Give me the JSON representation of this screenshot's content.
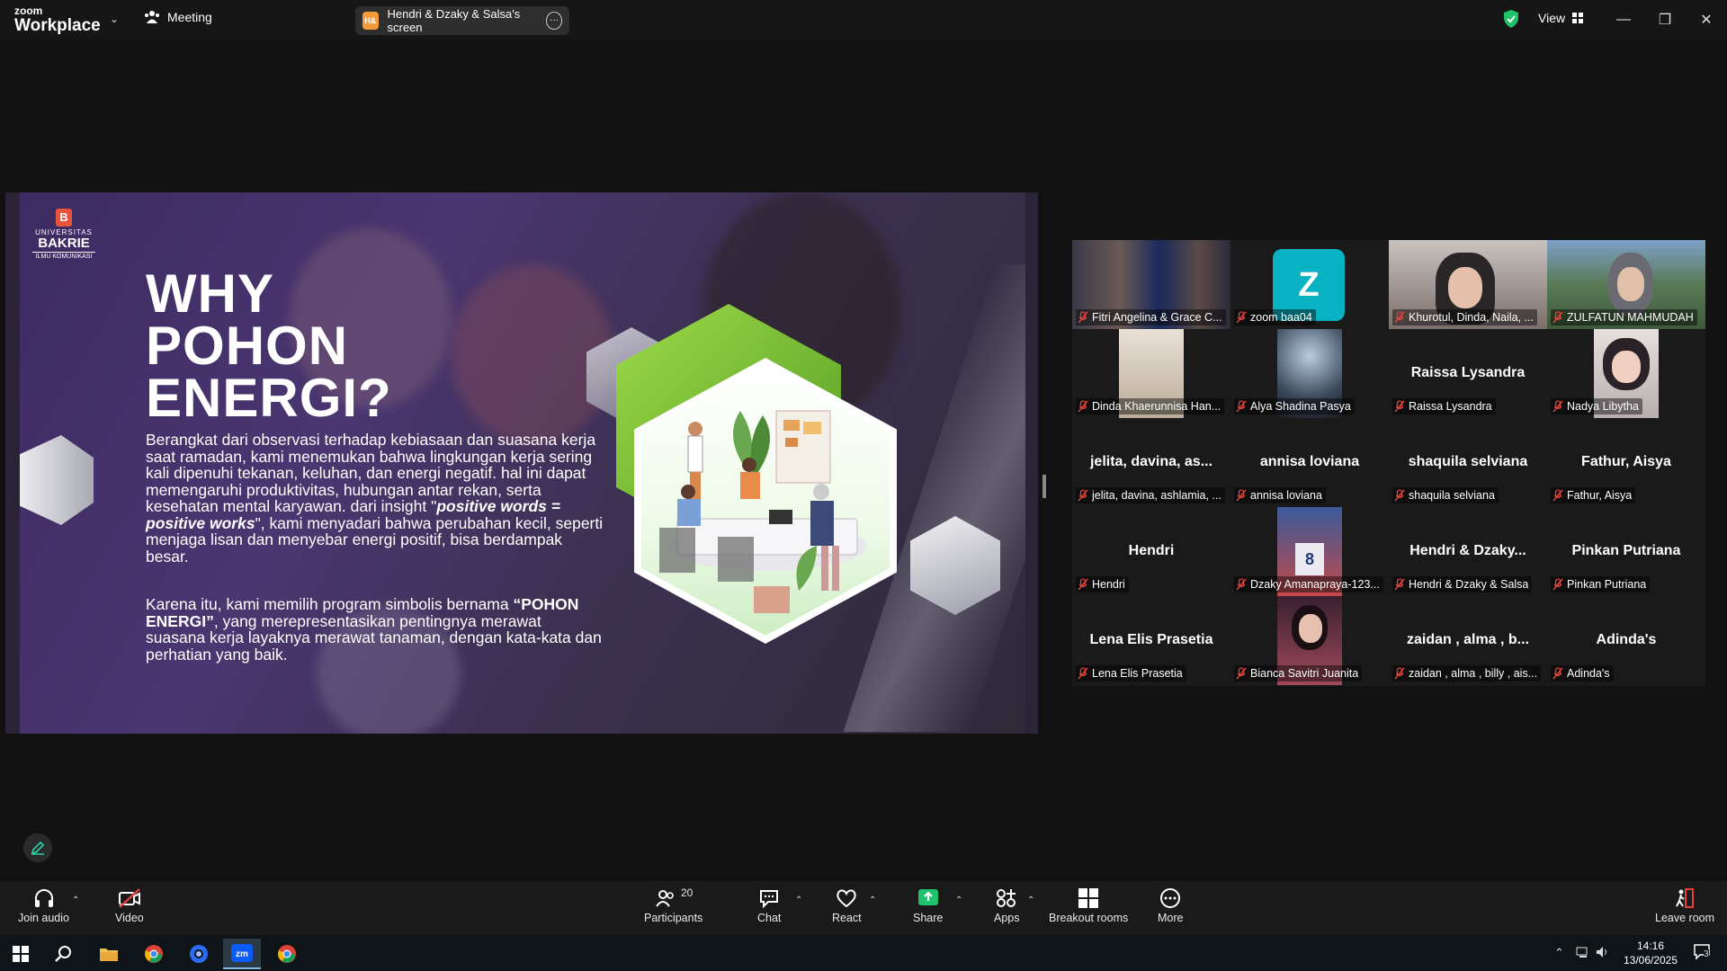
{
  "titlebar": {
    "brand_small": "zoom",
    "brand_big": "Workplace",
    "meeting_label": "Meeting",
    "share_pill_badge": "H&",
    "share_pill_label": "Hendri & Dzaky & Salsa's screen",
    "view_label": "View"
  },
  "slide": {
    "logo_line1": "UNIVERSITAS",
    "logo_line2": "BAKRIE",
    "logo_line3": "ILMU KOMUNIKASI",
    "title_line1": "WHY",
    "title_line2": "POHON",
    "title_line3": "ENERGI?",
    "para1_a": "Berangkat dari observasi terhadap kebiasaan dan suasana kerja saat ramadan, kami menemukan bahwa lingkungan kerja sering kali dipenuhi tekanan, keluhan, dan energi negatif. hal ini dapat memengaruhi produktivitas, hubungan antar rekan, serta kesehatan mental karyawan. dari insight \"",
    "para1_bold": "positive words = positive works",
    "para1_b": "\", kami menyadari bahwa perubahan kecil, seperti menjaga lisan dan menyebar energi positif, bisa berdampak besar.",
    "para2_a": "Karena itu, kami memilih program simbolis bernama ",
    "para2_bold": "“POHON ENERGI”",
    "para2_b": ", yang merepresentasikan pentingnya merawat suasana kerja layaknya merawat tanaman, dengan kata-kata dan perhatian yang baik."
  },
  "gallery": {
    "tiles": [
      {
        "label": "Fitri Angelina & Grace C...",
        "display": ""
      },
      {
        "label": "zoom baa04",
        "display": "Z"
      },
      {
        "label": "Khurotul, Dinda, Naila, ...",
        "display": ""
      },
      {
        "label": "ZULFATUN MAHMUDAH",
        "display": ""
      },
      {
        "label": "Dinda Khaerunnisa Han...",
        "display": ""
      },
      {
        "label": "Alya Shadina Pasya",
        "display": ""
      },
      {
        "label": "Raissa Lysandra",
        "display": "Raissa Lysandra"
      },
      {
        "label": "Nadya Libytha",
        "display": ""
      },
      {
        "label": "jelita, davina, ashlamia, ...",
        "display": "jelita, davina, as..."
      },
      {
        "label": "annisa loviana",
        "display": "annisa loviana"
      },
      {
        "label": "shaquila selviana",
        "display": "shaquila selviana"
      },
      {
        "label": "Fathur, Aisya",
        "display": "Fathur, Aisya"
      },
      {
        "label": "Hendri",
        "display": "Hendri"
      },
      {
        "label": "Dzaky Amanapraya-123...",
        "display": ""
      },
      {
        "label": "Hendri & Dzaky & Salsa",
        "display": "Hendri & Dzaky..."
      },
      {
        "label": "Pinkan Putriana",
        "display": "Pinkan Putriana"
      },
      {
        "label": "Lena Elis Prasetia",
        "display": "Lena Elis Prasetia"
      },
      {
        "label": "Bianca Savitri Juanita",
        "display": ""
      },
      {
        "label": "zaidan , alma , billy , ais...",
        "display": "zaidan , alma , b..."
      },
      {
        "label": "Adinda's",
        "display": "Adinda's"
      }
    ]
  },
  "toolbar": {
    "join_audio": "Join audio",
    "video": "Video",
    "participants": "Participants",
    "participants_count": "20",
    "chat": "Chat",
    "react": "React",
    "share": "Share",
    "apps": "Apps",
    "breakout": "Breakout rooms",
    "more": "More",
    "leave": "Leave room"
  },
  "taskbar": {
    "time": "14:16",
    "date": "13/06/2025",
    "notif_count": "3"
  },
  "colors": {
    "accent_green": "#2ed3a8",
    "share_green": "#1fc16b",
    "muted_red": "#e0433b",
    "zoom_blue": "#0b5cff"
  }
}
